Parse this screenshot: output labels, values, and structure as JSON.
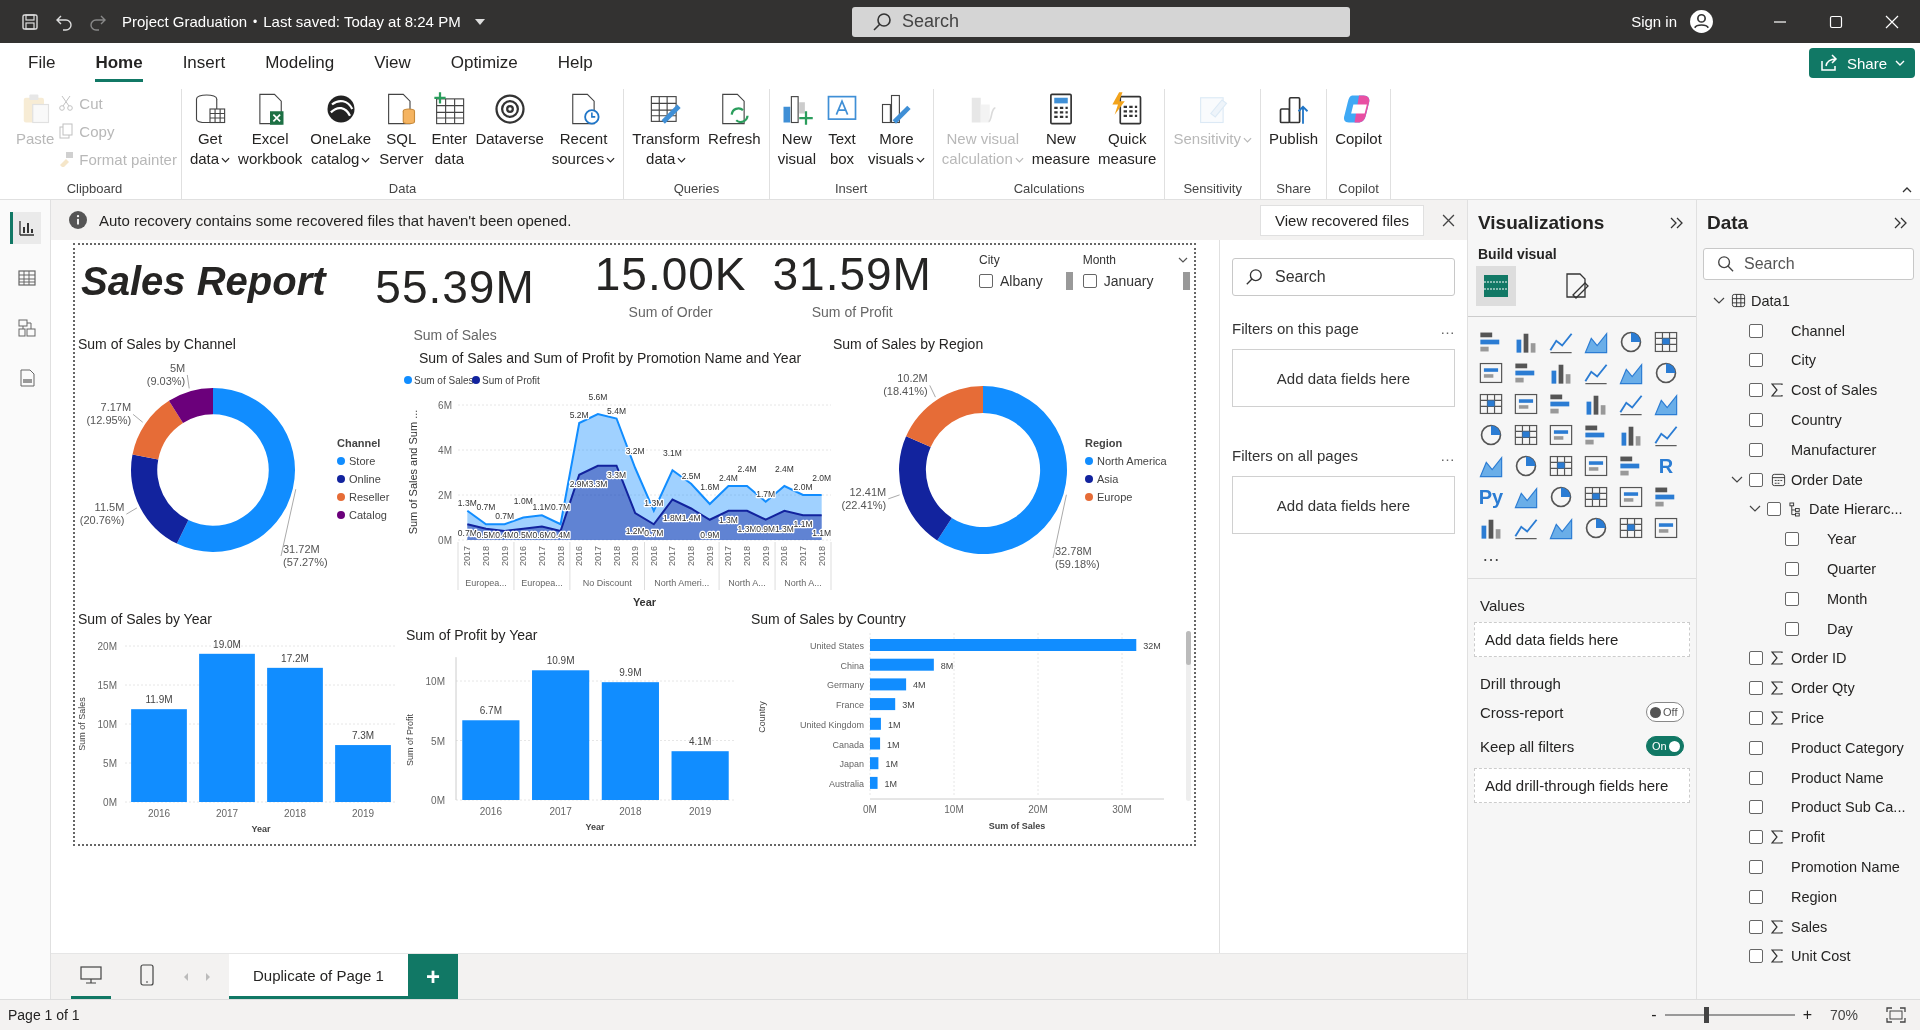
{
  "titlebar": {
    "file_name": "Project Graduation",
    "separator": "•",
    "saved": "Last saved: Today at 8:24 PM",
    "search_placeholder": "Search",
    "sign_in": "Sign in"
  },
  "ribbon_tabs": [
    {
      "label": "File",
      "selected": false
    },
    {
      "label": "Home",
      "selected": true
    },
    {
      "label": "Insert",
      "selected": false
    },
    {
      "label": "Modeling",
      "selected": false
    },
    {
      "label": "View",
      "selected": false
    },
    {
      "label": "Optimize",
      "selected": false
    },
    {
      "label": "Help",
      "selected": false
    }
  ],
  "share_button": "Share",
  "ribbon_groups": [
    {
      "label": "Clipboard",
      "buttons": [
        {
          "kind": "large",
          "lines": [
            "Paste"
          ],
          "disabled": true,
          "dropdown": false
        },
        {
          "kind": "small",
          "lines": [
            "Cut"
          ],
          "disabled": true,
          "dropdown": false
        },
        {
          "kind": "small",
          "lines": [
            "Copy"
          ],
          "disabled": true,
          "dropdown": false
        },
        {
          "kind": "small",
          "lines": [
            "Format painter"
          ],
          "disabled": true,
          "dropdown": false
        }
      ]
    },
    {
      "label": "Data",
      "buttons": [
        {
          "kind": "large",
          "lines": [
            "Get",
            "data"
          ],
          "disabled": false,
          "dropdown": true
        },
        {
          "kind": "large",
          "lines": [
            "Excel",
            "workbook"
          ],
          "disabled": false,
          "dropdown": false
        },
        {
          "kind": "large",
          "lines": [
            "OneLake",
            "catalog"
          ],
          "disabled": false,
          "dropdown": true
        },
        {
          "kind": "large",
          "lines": [
            "SQL",
            "Server"
          ],
          "disabled": false,
          "dropdown": false
        },
        {
          "kind": "large",
          "lines": [
            "Enter",
            "data"
          ],
          "disabled": false,
          "dropdown": false
        },
        {
          "kind": "large",
          "lines": [
            "Dataverse"
          ],
          "disabled": false,
          "dropdown": false
        },
        {
          "kind": "large",
          "lines": [
            "Recent",
            "sources"
          ],
          "disabled": false,
          "dropdown": true
        }
      ]
    },
    {
      "label": "Queries",
      "buttons": [
        {
          "kind": "large",
          "lines": [
            "Transform",
            "data"
          ],
          "disabled": false,
          "dropdown": true
        },
        {
          "kind": "large",
          "lines": [
            "Refresh"
          ],
          "disabled": false,
          "dropdown": false
        }
      ]
    },
    {
      "label": "Insert",
      "buttons": [
        {
          "kind": "large",
          "lines": [
            "New",
            "visual"
          ],
          "disabled": false,
          "dropdown": false
        },
        {
          "kind": "large",
          "lines": [
            "Text",
            "box"
          ],
          "disabled": false,
          "dropdown": false
        },
        {
          "kind": "large",
          "lines": [
            "More",
            "visuals"
          ],
          "disabled": false,
          "dropdown": true
        }
      ]
    },
    {
      "label": "Calculations",
      "buttons": [
        {
          "kind": "large",
          "lines": [
            "New visual",
            "calculation"
          ],
          "disabled": true,
          "dropdown": true
        },
        {
          "kind": "large",
          "lines": [
            "New",
            "measure"
          ],
          "disabled": false,
          "dropdown": false
        },
        {
          "kind": "large",
          "lines": [
            "Quick",
            "measure"
          ],
          "disabled": false,
          "dropdown": false
        }
      ]
    },
    {
      "label": "Sensitivity",
      "buttons": [
        {
          "kind": "large",
          "lines": [
            "Sensitivity"
          ],
          "disabled": true,
          "dropdown": true
        }
      ]
    },
    {
      "label": "Share",
      "buttons": [
        {
          "kind": "large",
          "lines": [
            "Publish"
          ],
          "disabled": false,
          "dropdown": false
        }
      ]
    },
    {
      "label": "Copilot",
      "buttons": [
        {
          "kind": "large",
          "lines": [
            "Copilot"
          ],
          "disabled": false,
          "dropdown": false
        }
      ]
    }
  ],
  "left_rail": [
    {
      "selected": true
    },
    {
      "selected": false
    },
    {
      "selected": false
    },
    {
      "selected": false
    }
  ],
  "info_bar": {
    "message": "Auto recovery contains some recovered files that haven't been opened.",
    "action": "View recovered files"
  },
  "report": {
    "title": "Sales Report",
    "kpis": [
      {
        "value": "55.39M",
        "label": "Sum of Sales"
      },
      {
        "value": "15.00K",
        "label": "Sum of Order"
      },
      {
        "value": "31.59M",
        "label": "Sum of Profit"
      }
    ],
    "slicers": [
      {
        "title": "City",
        "dropdown": false,
        "options": [
          {
            "label": "Albany",
            "checked": false
          }
        ]
      },
      {
        "title": "Month",
        "dropdown": true,
        "options": [
          {
            "label": "January",
            "checked": false
          }
        ]
      }
    ],
    "channel_chart": {
      "chart_data": {
        "type": "donut",
        "title": "Sum of Sales by Channel",
        "legend": {
          "title": "Channel"
        },
        "categories": [
          "Store",
          "Online",
          "Reseller",
          "Catalog"
        ],
        "colors": [
          "#118dff",
          "#12239e",
          "#e66c37",
          "#6b007b"
        ],
        "values": [
          57.27,
          20.76,
          12.95,
          9.03
        ],
        "value_labels": [
          "31.72M (57.27%)",
          "11.5M (20.76%)",
          "7.17M (12.95%)",
          "5M (9.03%)"
        ]
      }
    },
    "promotion_chart": {
      "chart_data": {
        "type": "area",
        "title": "Sum of Sales and Sum of Profit by Promotion Name and Year",
        "legend": true,
        "grid": true,
        "xlabel": "Year",
        "ylabel": "Sum of Sales and Sum ...",
        "ylim": [
          0,
          6
        ],
        "yticks": [
          {
            "value": 0,
            "label": "0M"
          },
          {
            "value": 2,
            "label": "2M"
          },
          {
            "value": 4,
            "label": "4M"
          },
          {
            "value": 6,
            "label": "6M"
          }
        ],
        "categories": [
          "2017",
          "2018",
          "2019",
          "2016",
          "2017",
          "2018",
          "2016",
          "2017",
          "2018",
          "2019",
          "2016",
          "2017",
          "2018",
          "2019",
          "2017",
          "2018",
          "2019",
          "2016",
          "2017",
          "2018"
        ],
        "annotations": [
          "Europea...",
          "Europea...",
          "No Discount",
          "North Ameri...",
          "North A...",
          "North A..."
        ],
        "series": [
          {
            "name": "Sum of Sales",
            "color": "#118dff",
            "values": [
              1.3,
              0.7,
              0.7,
              1.0,
              1.1,
              0.7,
              5.2,
              5.6,
              5.4,
              3.2,
              1.3,
              3.1,
              2.5,
              1.6,
              2.4,
              2.4,
              1.7,
              2.4,
              2.0,
              2.0
            ],
            "value_labels": [
              "1.3M",
              "0.7M",
              "0.7M",
              "1.0M",
              "1.1M",
              "0.7M",
              "5.2M",
              "5.6M",
              "5.4M",
              "3.2M",
              "1.3M",
              "3.1M",
              "2.5M",
              "1.6M",
              "2.4M",
              "2.4M",
              "1.7M",
              "2.4M",
              "2.0M",
              "2.0M"
            ]
          },
          {
            "name": "Sum of Profit",
            "color": "#12239e",
            "values": [
              0.7,
              0.5,
              0.4,
              0.5,
              0.6,
              0.4,
              2.9,
              3.3,
              3.3,
              1.2,
              0.7,
              1.8,
              1.4,
              0.9,
              1.3,
              1.3,
              0.9,
              1.3,
              1.1,
              1.1
            ],
            "value_labels": [
              "0.7M",
              "0.5M",
              "0.4M",
              "0.5M",
              "0.6M",
              "0.4M",
              "2.9M",
              "3.3M",
              "3.3M",
              "1.2M",
              "0.7M",
              "1.8M",
              "1.4M",
              "0.9M",
              "1.3M",
              "1.3M",
              "0.9M",
              "1.3M",
              "1.1M",
              "1.1M"
            ]
          }
        ],
        "data_labels": true
      }
    },
    "region_chart": {
      "chart_data": {
        "type": "donut",
        "title": "Sum of Sales by Region",
        "legend": {
          "title": "Region"
        },
        "categories": [
          "North America",
          "Asia",
          "Europe"
        ],
        "colors": [
          "#118dff",
          "#12239e",
          "#e66c37"
        ],
        "values": [
          59.18,
          22.41,
          18.41
        ],
        "value_labels": [
          "32.78M (59.18%)",
          "12.41M (22.41%)",
          "10.2M (18.41%)"
        ]
      }
    },
    "year_sales_chart": {
      "chart_data": {
        "type": "bar",
        "title": "Sum of Sales by Year",
        "grid": true,
        "xlabel": "Year",
        "ylabel": "Sum of Sales",
        "categories": [
          "2016",
          "2017",
          "2018",
          "2019"
        ],
        "ylim": [
          0,
          20
        ],
        "yticks": [
          {
            "value": 0,
            "label": "0M"
          },
          {
            "value": 5,
            "label": "5M"
          },
          {
            "value": 10,
            "label": "10M"
          },
          {
            "value": 15,
            "label": "15M"
          },
          {
            "value": 20,
            "label": "20M"
          }
        ],
        "series": [
          {
            "color": "#118dff",
            "values": [
              11.9,
              19.0,
              17.2,
              7.3
            ]
          }
        ],
        "value_labels": [
          "11.9M",
          "19.0M",
          "17.2M",
          "7.3M"
        ]
      }
    },
    "year_profit_chart": {
      "chart_data": {
        "type": "bar",
        "title": "Sum of Profit by Year",
        "grid": true,
        "xlabel": "Year",
        "ylabel": "Sum of Profit",
        "categories": [
          "2016",
          "2017",
          "2018",
          "2019"
        ],
        "ylim": [
          0,
          12
        ],
        "yticks": [
          {
            "value": 0,
            "label": "0M"
          },
          {
            "value": 5,
            "label": "5M"
          },
          {
            "value": 10,
            "label": "10M"
          }
        ],
        "series": [
          {
            "color": "#118dff",
            "values": [
              6.7,
              10.9,
              9.9,
              4.1
            ]
          }
        ],
        "value_labels": [
          "6.7M",
          "10.9M",
          "9.9M",
          "4.1M"
        ]
      }
    },
    "country_chart": {
      "chart_data": {
        "type": "bar",
        "orientation": "horizontal",
        "title": "Sum of Sales by Country",
        "grid": true,
        "xlabel": "Sum of Sales",
        "ylabel": "Country",
        "categories": [
          "United States",
          "China",
          "Germany",
          "France",
          "United Kingdom",
          "Canada",
          "Japan",
          "Australia"
        ],
        "xlim": [
          0,
          35
        ],
        "xticks": [
          {
            "value": 0,
            "label": "0M"
          },
          {
            "value": 10,
            "label": "10M"
          },
          {
            "value": 20,
            "label": "20M"
          },
          {
            "value": 30,
            "label": "30M"
          }
        ],
        "series": [
          {
            "color": "#118dff",
            "values": [
              31.7,
              7.6,
              4.3,
              3.0,
              1.3,
              1.2,
              1.0,
              0.9
            ]
          }
        ],
        "value_labels": [
          "32M",
          "8M",
          "4M",
          "3M",
          "1M",
          "1M",
          "1M",
          "1M"
        ]
      }
    }
  },
  "filters": {
    "search_placeholder": "Search",
    "sections": [
      {
        "title": "Filters on this page",
        "more": "…",
        "drop": "Add data fields here"
      },
      {
        "title": "Filters on all pages",
        "more": "…",
        "drop": "Add data fields here"
      }
    ]
  },
  "visualizations": {
    "title": "Visualizations",
    "build_label": "Build visual",
    "modes": [
      {
        "selected": true
      },
      {
        "selected": false
      }
    ],
    "text_icons": [
      "R",
      "Py"
    ],
    "more": "…",
    "values_label": "Values",
    "values_drop": "Add data fields here",
    "drill_title": "Drill through",
    "toggles": [
      {
        "label": "Cross-report",
        "on": false,
        "state_text": "Off"
      },
      {
        "label": "Keep all filters",
        "on": true,
        "state_text": "On"
      }
    ],
    "drill_drop": "Add drill-through fields here"
  },
  "data_pane": {
    "title": "Data",
    "search_placeholder": "Search",
    "tree": [
      {
        "label": "Data1",
        "kind": "table",
        "expanded": true,
        "children": [
          {
            "label": "Channel",
            "kind": "field",
            "checked": false
          },
          {
            "label": "City",
            "kind": "field",
            "checked": false
          },
          {
            "label": "Cost of Sales",
            "kind": "measure",
            "checked": false
          },
          {
            "label": "Country",
            "kind": "field",
            "checked": false
          },
          {
            "label": "Manufacturer",
            "kind": "field",
            "checked": false
          },
          {
            "label": "Order Date",
            "kind": "date",
            "checked": false,
            "expanded": true,
            "children": [
              {
                "label": "Date Hierarc...",
                "kind": "hierarchy",
                "checked": false,
                "expanded": true,
                "children": [
                  {
                    "label": "Year",
                    "checked": false
                  },
                  {
                    "label": "Quarter",
                    "checked": false
                  },
                  {
                    "label": "Month",
                    "checked": false
                  },
                  {
                    "label": "Day",
                    "checked": false
                  }
                ]
              }
            ]
          },
          {
            "label": "Order ID",
            "kind": "measure",
            "checked": false
          },
          {
            "label": "Order Qty",
            "kind": "measure",
            "checked": false
          },
          {
            "label": "Price",
            "kind": "measure",
            "checked": false
          },
          {
            "label": "Product Category",
            "kind": "field",
            "checked": false
          },
          {
            "label": "Product Name",
            "kind": "field",
            "checked": false
          },
          {
            "label": "Product Sub Ca...",
            "kind": "field",
            "checked": false
          },
          {
            "label": "Profit",
            "kind": "measure",
            "checked": false
          },
          {
            "label": "Promotion Name",
            "kind": "field",
            "checked": false
          },
          {
            "label": "Region",
            "kind": "field",
            "checked": false
          },
          {
            "label": "Sales",
            "kind": "measure",
            "checked": false
          },
          {
            "label": "Unit Cost",
            "kind": "measure",
            "checked": false
          }
        ]
      }
    ]
  },
  "page_tabs": {
    "views": [
      {
        "selected": true
      },
      {
        "selected": false
      }
    ],
    "pages": [
      {
        "label": "Duplicate of Page 1",
        "selected": true
      }
    ],
    "add": "+"
  },
  "status": {
    "page": "Page 1 of 1",
    "zoom_minus": "-",
    "zoom_plus": "+",
    "zoom_label": "70%",
    "level": 0.3
  }
}
